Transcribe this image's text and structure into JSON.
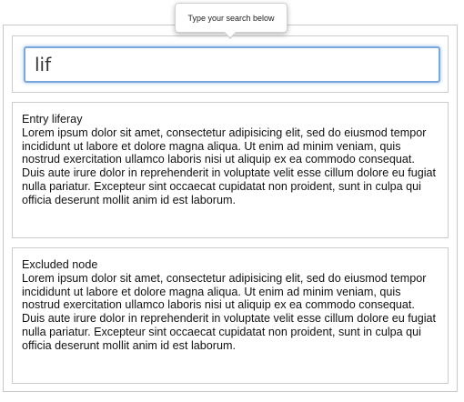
{
  "tooltip": {
    "text": "Type your search below"
  },
  "search": {
    "value": "lif",
    "placeholder": ""
  },
  "entries": [
    {
      "title": "Entry liferay",
      "body": "Lorem ipsum dolor sit amet, consectetur adipisicing elit, sed do eiusmod tempor incididunt ut labore et dolore magna aliqua. Ut enim ad minim veniam, quis nostrud exercitation ullamco laboris nisi ut aliquip ex ea commodo consequat. Duis aute irure dolor in reprehenderit in voluptate velit esse cillum dolore eu fugiat nulla pariatur. Excepteur sint occaecat cupidatat non proident, sunt in culpa qui officia deserunt mollit anim id est laborum."
    },
    {
      "title": "Excluded node",
      "body": "Lorem ipsum dolor sit amet, consectetur adipisicing elit, sed do eiusmod tempor incididunt ut labore et dolore magna aliqua. Ut enim ad minim veniam, quis nostrud exercitation ullamco laboris nisi ut aliquip ex ea commodo consequat. Duis aute irure dolor in reprehenderit in voluptate velit esse cillum dolore eu fugiat nulla pariatur. Excepteur sint occaecat cupidatat non proident, sunt in culpa qui officia deserunt mollit anim id est laborum."
    }
  ],
  "colors": {
    "focus_ring": "#7ba8dc",
    "border": "#cccccc"
  }
}
